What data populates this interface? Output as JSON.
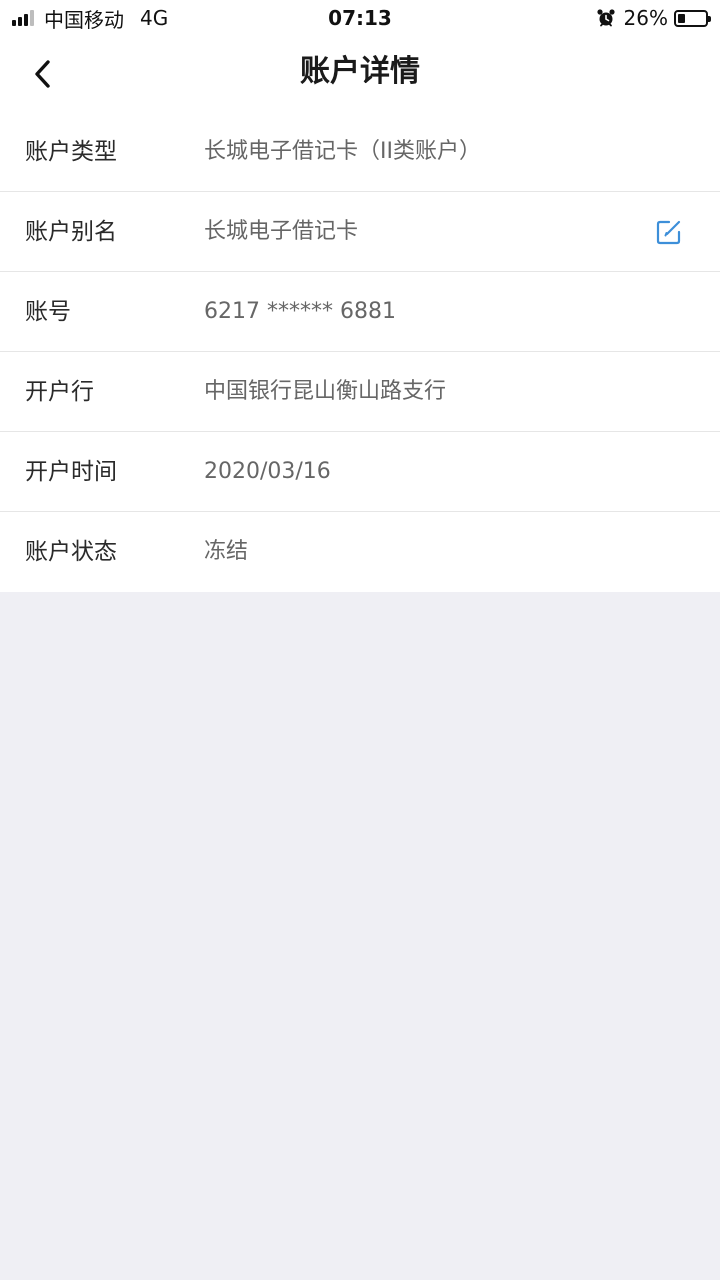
{
  "status_bar": {
    "carrier": "中国移动",
    "network": "4G",
    "time": "07:13",
    "battery_percent": "26%",
    "battery_level": 0.26
  },
  "nav": {
    "title": "账户详情",
    "back_icon": "chevron-left-icon"
  },
  "details": [
    {
      "label": "账户类型",
      "value": "长城电子借记卡（II类账户）"
    },
    {
      "label": "账户别名",
      "value": "长城电子借记卡",
      "edit_icon": "edit-icon"
    },
    {
      "label": "账号",
      "value": "6217 ****** 6881"
    },
    {
      "label": "开户行",
      "value": "中国银行昆山衡山路支行"
    },
    {
      "label": "开户时间",
      "value": "2020/03/16"
    },
    {
      "label": "账户状态",
      "value": "冻结"
    }
  ],
  "colors": {
    "accent": "#3d8fd9",
    "background": "#efeff4",
    "card": "#ffffff"
  }
}
